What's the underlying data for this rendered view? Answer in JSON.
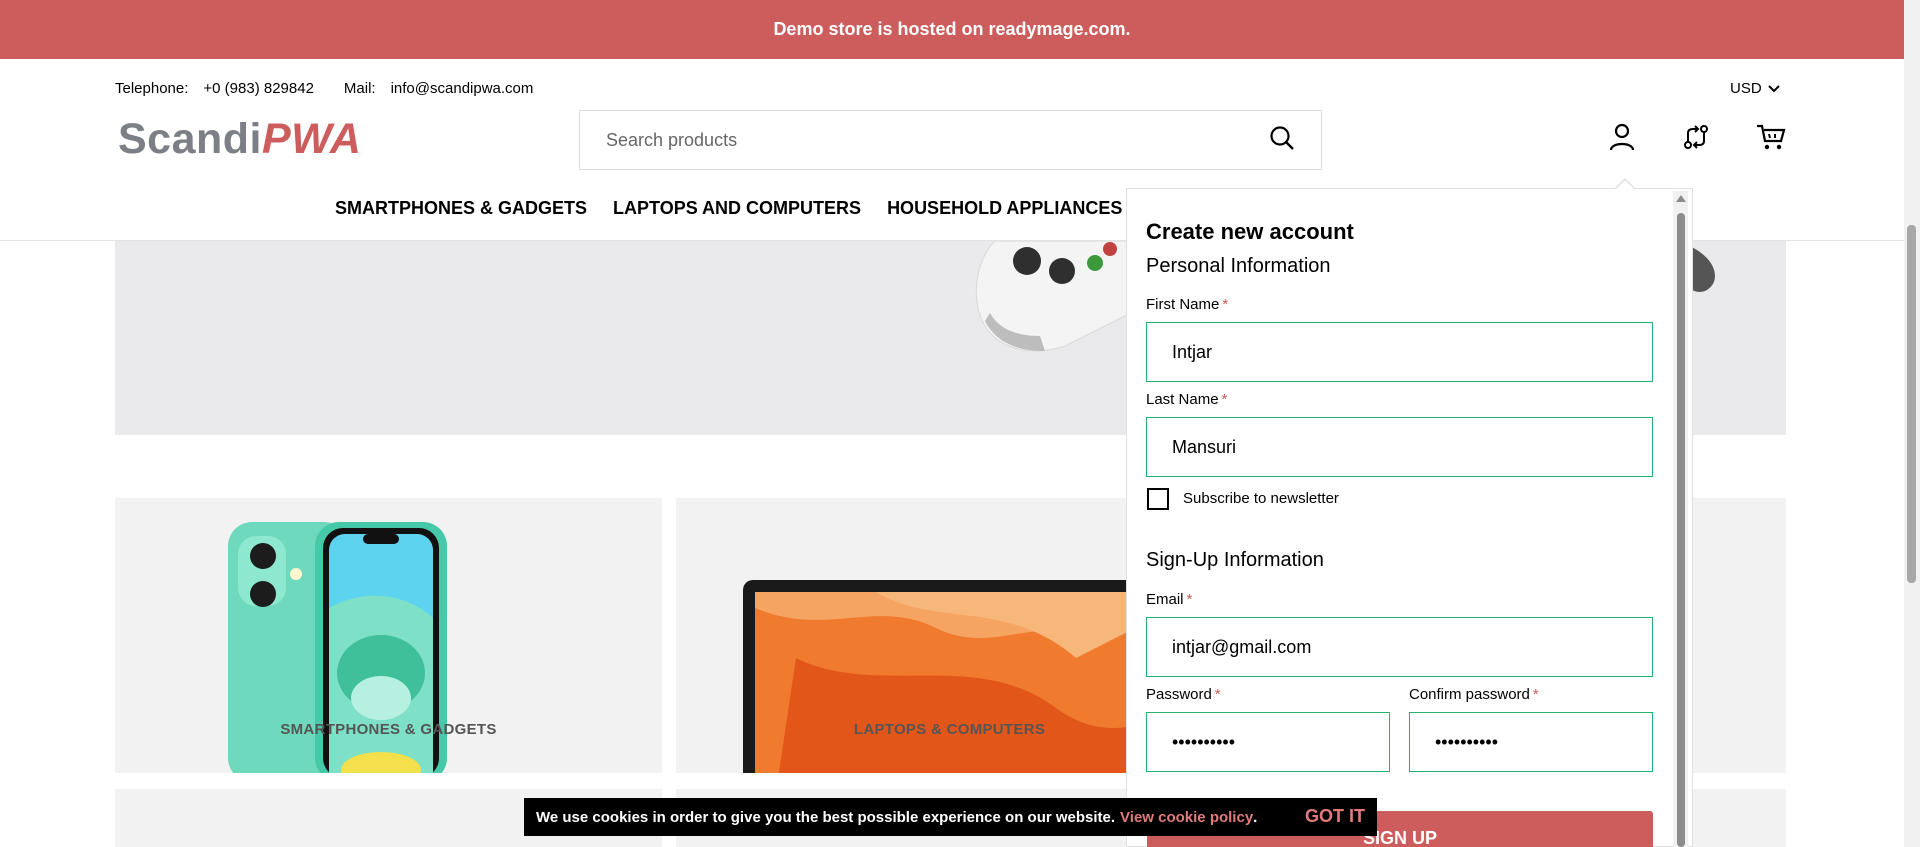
{
  "banner": {
    "text": "Demo store is hosted on readymage.com."
  },
  "contact": {
    "telephone_label": "Telephone:",
    "telephone_value": "+0 (983) 829842",
    "mail_label": "Mail:",
    "mail_value": "info@scandipwa.com"
  },
  "currency": {
    "selected": "USD",
    "icon": "chevron-down-icon"
  },
  "logo": {
    "part1": "Scandi",
    "part2": "PWA"
  },
  "search": {
    "placeholder": "Search products",
    "icon": "search-icon"
  },
  "header_icons": [
    "account-icon",
    "compare-icon",
    "cart-icon"
  ],
  "nav": {
    "items": [
      "SMARTPHONES & GADGETS",
      "LAPTOPS AND COMPUTERS",
      "HOUSEHOLD APPLIANCES"
    ]
  },
  "tiles": [
    {
      "label": "SMARTPHONES & GADGETS"
    },
    {
      "label": "LAPTOPS & COMPUTERS"
    }
  ],
  "popup": {
    "title": "Create new account",
    "personal_section": "Personal Information",
    "first_name_label": "First Name",
    "first_name_value": "Intjar",
    "last_name_label": "Last Name",
    "last_name_value": "Mansuri",
    "newsletter_label": "Subscribe to newsletter",
    "newsletter_checked": false,
    "signup_section": "Sign-Up Information",
    "email_label": "Email",
    "email_value": "intjar@gmail.com",
    "password_label": "Password",
    "password_value": "••••••••••",
    "confirm_label": "Confirm password",
    "confirm_value": "••••••••••",
    "required_mark": "*",
    "submit_label": "SIGN UP"
  },
  "cookie": {
    "message": "We use cookies in order to give you the best possible experience on our website.",
    "link_text": "View cookie policy",
    "period": ".",
    "accept_label": "GOT IT"
  },
  "colors": {
    "brand": "#cd5c5c",
    "input_border": "#23b36e",
    "logo_grey": "#7d7f87"
  }
}
